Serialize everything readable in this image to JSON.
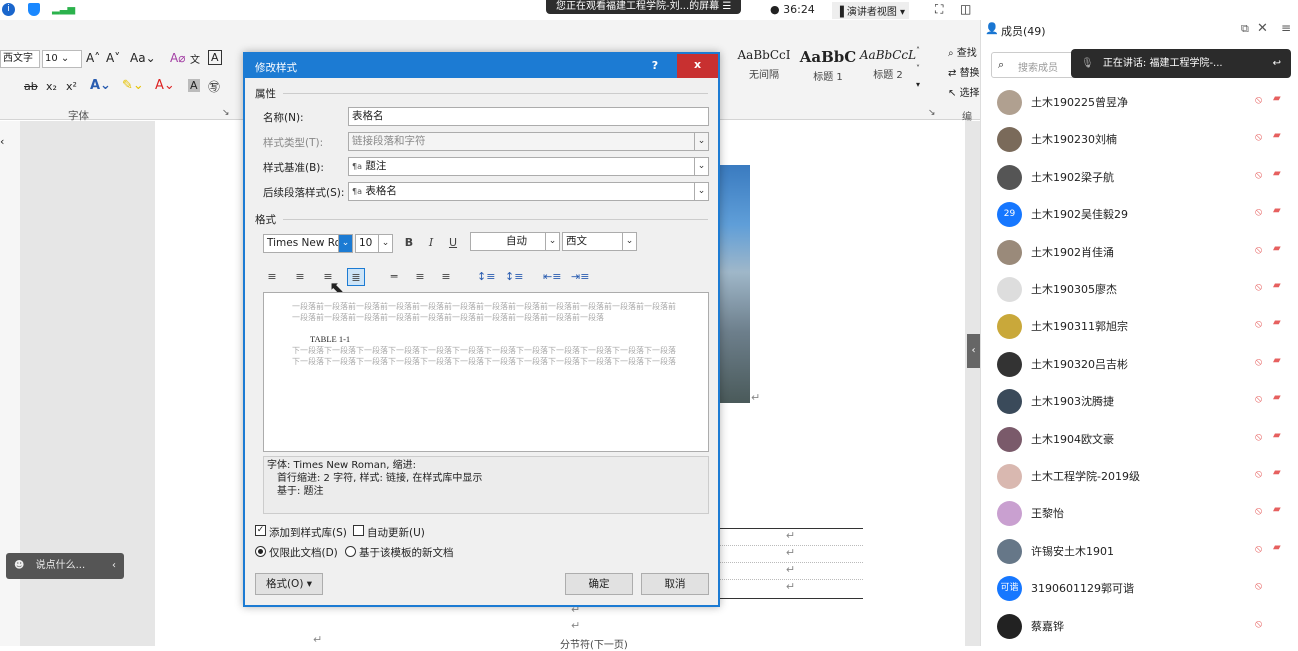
{
  "share_banner": "您正在观看福建工程学院-刘...的屏幕",
  "meeting": {
    "timer": "36:24",
    "view_mode": "演讲者视图",
    "members_title": "成员(49)",
    "search_placeholder": "搜索成员",
    "speaking": "正在讲话: 福建工程学院-..."
  },
  "ribbon": {
    "font_group": "字体",
    "edit_group": "编辑",
    "font_name": "西文字",
    "styles": [
      {
        "sample": "AaBbCcI",
        "label": "无间隔"
      },
      {
        "sample": "AaBbC",
        "label": "标题 1"
      },
      {
        "sample": "AaBbCcL",
        "label": "标题 2"
      }
    ],
    "find": "查找",
    "replace": "替换",
    "select": "选择"
  },
  "dialog": {
    "title": "修改样式",
    "help": "?",
    "close": "x",
    "section_props": "属性",
    "name_label": "名称(N):",
    "name_value": "表格名",
    "type_label": "样式类型(T):",
    "type_value": "链接段落和字符",
    "base_label": "样式基准(B):",
    "base_value": "题注",
    "next_label": "后续段落样式(S):",
    "next_value": "表格名",
    "section_format": "格式",
    "font": "Times New Ro",
    "size": "10",
    "color": "自动",
    "script": "西文",
    "preview_prev": "前一段落前一段落前一段落前一段落前一段落前一段落前一段落前一段落前一段落前一段落前一段落前一段落前一段落前一段落前一段落前一段落前一段落前一段落前一段落前一段落前一段落前一段落",
    "preview_sample": "TABLE 1-1",
    "preview_next": "下一段落下一段落下一段落下一段落下一段落下一段落下一段落下一段落下一段落下一段落下一段落下一段落下一段落下一段落下一段落下一段落下一段落下一段落下一段落下一段落下一段落下一段落下一段落下一段落",
    "desc_line1": "字体: Times New Roman, 缩进:",
    "desc_line2": "首行缩进: 2 字符, 样式: 链接, 在样式库中显示",
    "desc_line3": "基于: 题注",
    "add_to_gallery": "添加到样式库(S)",
    "auto_update": "自动更新(U)",
    "only_doc": "仅限此文档(D)",
    "new_template": "基于该模板的新文档",
    "format_btn": "格式(O)",
    "ok": "确定",
    "cancel": "取消"
  },
  "document": {
    "section_break": "分节符(下一页)"
  },
  "chat": {
    "placeholder": "说点什么..."
  },
  "members": [
    {
      "name": "土木190225曾昱净",
      "badge": "",
      "color": "#b0a090"
    },
    {
      "name": "土木190230刘楠",
      "badge": "",
      "color": "#7a6a5a"
    },
    {
      "name": "土木1902梁子航",
      "badge": "",
      "color": "#555"
    },
    {
      "name": "土木1902吴佳毅29",
      "badge": "29",
      "color": "#1677ff"
    },
    {
      "name": "土木1902肖佳涌",
      "badge": "",
      "color": "#9a8a7a"
    },
    {
      "name": "土木190305廖杰",
      "badge": "",
      "color": "#ddd"
    },
    {
      "name": "土木190311郭旭宗",
      "badge": "",
      "color": "#c9a83a"
    },
    {
      "name": "土木190320吕吉彬",
      "badge": "",
      "color": "#333"
    },
    {
      "name": "土木1903沈腾捷",
      "badge": "",
      "color": "#3a4a5a"
    },
    {
      "name": "土木1904欧文豪",
      "badge": "",
      "color": "#7a5a6a"
    },
    {
      "name": "土木工程学院-2019级",
      "badge": "",
      "color": "#d9b8b0"
    },
    {
      "name": "王黎怡",
      "badge": "",
      "color": "#c9a0d0"
    },
    {
      "name": "许锡安土木1901",
      "badge": "",
      "color": "#667788"
    },
    {
      "name": "3190601129郭可谐",
      "badge": "可谐",
      "color": "#1677ff"
    },
    {
      "name": "蔡嘉铧",
      "badge": "",
      "color": "#222"
    }
  ]
}
